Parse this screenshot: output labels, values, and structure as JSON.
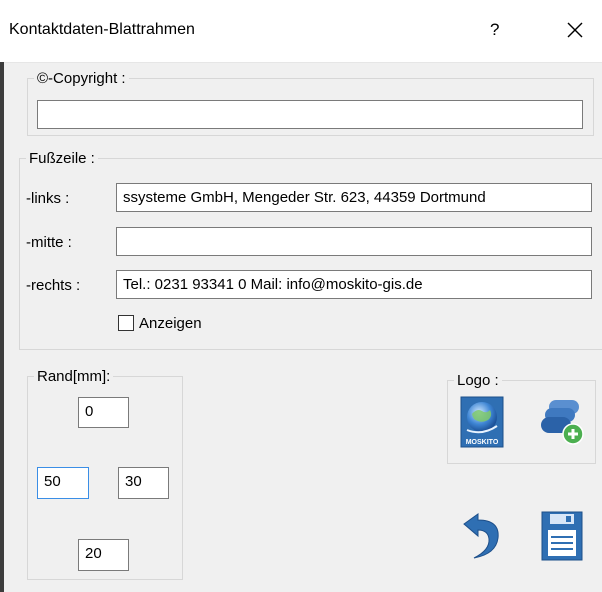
{
  "window": {
    "title": "Kontaktdaten-Blattrahmen",
    "help_label": "?",
    "close_icon": "close-icon"
  },
  "copyright": {
    "legend": "©-Copyright :",
    "value": ""
  },
  "footer": {
    "legend": "Fußzeile :",
    "left_label": "-links :",
    "left_value": "ssysteme GmbH, Mengeder Str. 623, 44359 Dortmund",
    "center_label": "-mitte  :",
    "center_value": "",
    "right_label": "-rechts :",
    "right_value": "Tel.: 0231 93341 0   Mail: info@moskito-gis.de",
    "show_label": "Anzeigen",
    "show_checked": false
  },
  "margin": {
    "legend": "Rand[mm]:",
    "top": "0",
    "left": "50",
    "right": "30",
    "bottom": "20"
  },
  "logo": {
    "legend": "Logo :",
    "moskito_logo_icon": "moskito-globe-logo-icon",
    "moskito_logo_text": "MOSKITO",
    "add_layer_icon": "add-layer-icon"
  },
  "actions": {
    "undo_icon": "undo-icon",
    "save_icon": "save-icon"
  },
  "colors": {
    "accent_blue": "#2f6fb3",
    "add_green": "#4caf50"
  }
}
